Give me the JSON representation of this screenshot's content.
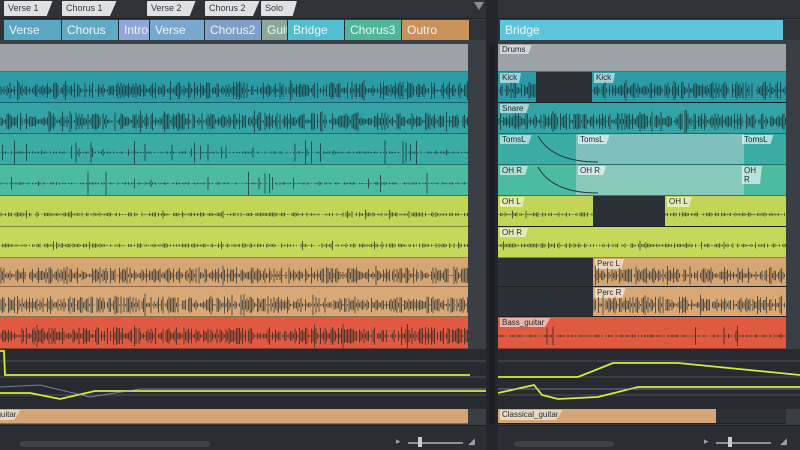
{
  "markers": [
    "Verse 1",
    "Chorus 1",
    "Verse 2",
    "Chorus 2",
    "Solo"
  ],
  "arrangement_left": [
    {
      "label": "Verse",
      "color": "#5aa6c3"
    },
    {
      "label": "Chorus",
      "color": "#60aac5"
    },
    {
      "label": "Intro",
      "color": "#8fa7d8"
    },
    {
      "label": "Verse",
      "color": "#79a8cf"
    },
    {
      "label": "Chorus2",
      "color": "#7f9ec8"
    },
    {
      "label": "Guit",
      "color": "#8ba79a"
    },
    {
      "label": "Bridge",
      "color": "#52bfd0"
    },
    {
      "label": "Chorus3",
      "color": "#4fb59b"
    },
    {
      "label": "Outro",
      "color": "#c9925a"
    }
  ],
  "arrangement_right": {
    "label": "Bridge",
    "color": "#5ec6dc"
  },
  "clip_labels": {
    "drums": "Drums",
    "kick": "Kick",
    "snare": "Snare",
    "toms": "TomsL",
    "ohl": "OH L",
    "ohr": "OH R",
    "percl": "Perc L",
    "percr": "Perc R",
    "bass": "Bass_guitar",
    "classical": "Classical_guitar"
  },
  "colors": {
    "teal_dark": "#2d9ba6",
    "teal": "#3aaca3",
    "teal_light": "#4dbba0",
    "lime": "#c3d556",
    "sand": "#d6a574",
    "red": "#df5a40",
    "drums_gray": "#9da2a7",
    "automation": "#d6ec3c"
  }
}
